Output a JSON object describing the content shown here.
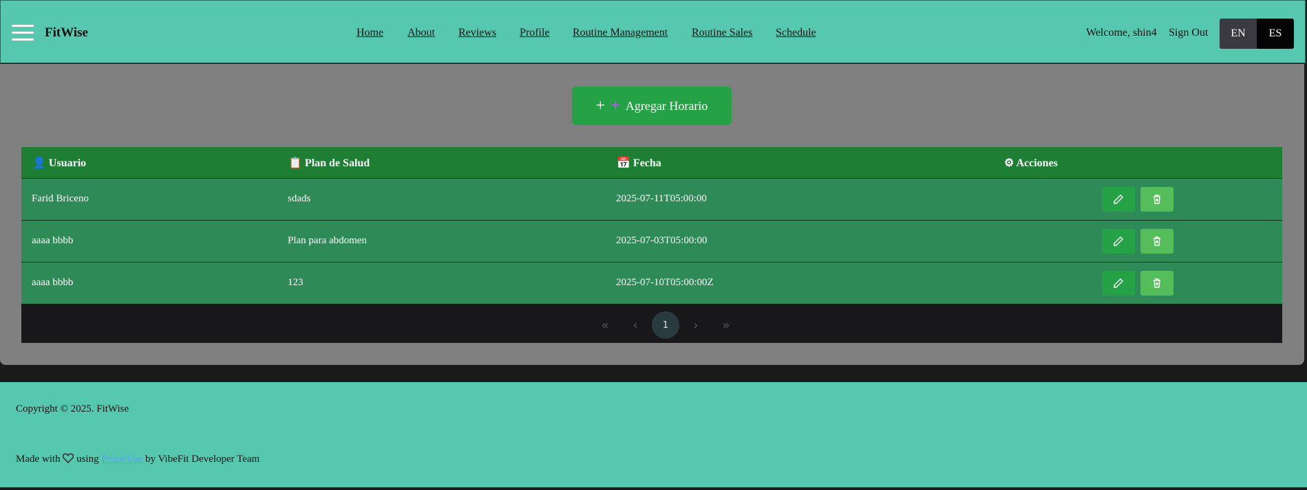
{
  "header": {
    "brand": "FitWise",
    "nav": [
      {
        "label": "Home"
      },
      {
        "label": "About"
      },
      {
        "label": "Reviews"
      },
      {
        "label": "Profile"
      },
      {
        "label": "Routine Management"
      },
      {
        "label": "Routine Sales"
      },
      {
        "label": "Schedule"
      }
    ],
    "welcome": "Welcome, shin4",
    "signout": "Sign Out",
    "lang_en": "EN",
    "lang_es": "ES"
  },
  "main": {
    "add_button_label": "Agregar Horario",
    "columns": [
      {
        "icon": "👤",
        "label": "Usuario"
      },
      {
        "icon": "📋",
        "label": "Plan de Salud"
      },
      {
        "icon": "📅",
        "label": "Fecha"
      },
      {
        "icon": "⚙",
        "label": "Acciones"
      }
    ],
    "rows": [
      {
        "usuario": "Farid Briceno",
        "plan": "sdads",
        "fecha": "2025-07-11T05:00:00"
      },
      {
        "usuario": "aaaa bbbb",
        "plan": "Plan para abdomen",
        "fecha": "2025-07-03T05:00:00"
      },
      {
        "usuario": "aaaa bbbb",
        "plan": "123",
        "fecha": "2025-07-10T05:00:00Z"
      }
    ],
    "pagination": {
      "current_page": "1"
    }
  },
  "footer": {
    "copyright": "Copyright © 2025. FitWise",
    "made_prefix": "Made with",
    "made_using": "using",
    "made_link": "PrimeVue",
    "made_suffix": "by VibeFit Developer Team"
  },
  "colors": {
    "header_bg": "#57c8b0",
    "table_header_bg": "#1e7f34",
    "row_bg": "#2e8b57",
    "add_button_bg": "#25a245"
  }
}
